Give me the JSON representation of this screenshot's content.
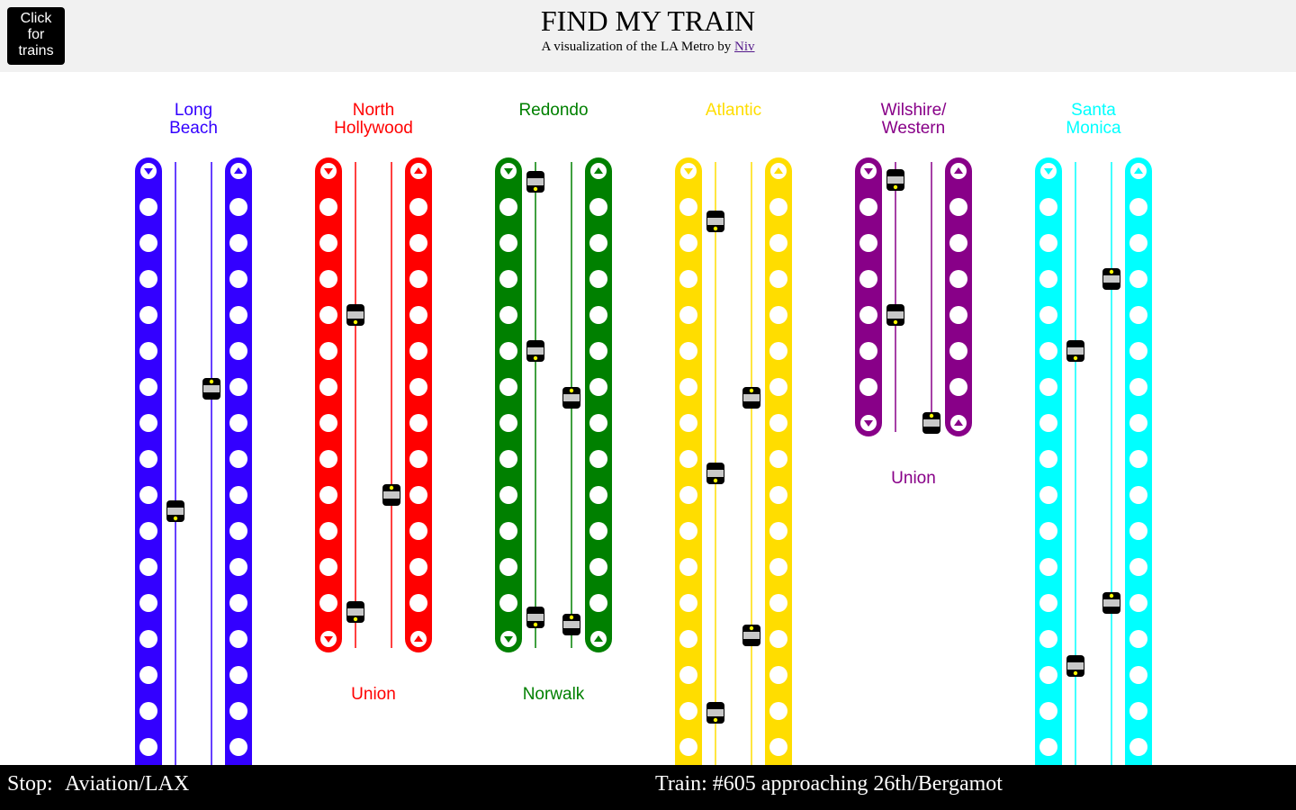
{
  "header": {
    "title": "FIND MY TRAIN",
    "subtitle_prefix": "A visualization of the LA Metro by ",
    "author_link": "Niv",
    "trains_button": [
      "Click",
      "for",
      "trains"
    ]
  },
  "lines": [
    {
      "id": "blue",
      "color": "#3300ff",
      "top_label": [
        "Long",
        "Beach"
      ],
      "bottom_label": "",
      "stops": 17,
      "continues": true,
      "trains": {
        "down": [
          9.45
        ],
        "up": [
          6.05
        ]
      }
    },
    {
      "id": "red",
      "color": "#ff0000",
      "top_label": [
        "North",
        "Hollywood"
      ],
      "bottom_label": "Union",
      "stops": 14,
      "continues": false,
      "trains": {
        "down": [
          4.0,
          12.25
        ],
        "up": [
          9.0
        ]
      }
    },
    {
      "id": "green",
      "color": "#008000",
      "top_label": [
        "Redondo"
      ],
      "bottom_label": "Norwalk",
      "stops": 14,
      "continues": false,
      "trains": {
        "down": [
          0.3,
          5.0,
          12.4
        ],
        "up": [
          6.3,
          12.6
        ]
      }
    },
    {
      "id": "gold",
      "color": "#ffdd00",
      "top_label": [
        "Atlantic"
      ],
      "bottom_label": "",
      "stops": 17,
      "continues": true,
      "trains": {
        "down": [
          1.4,
          8.4,
          15.05
        ],
        "up": [
          6.3,
          12.9
        ]
      }
    },
    {
      "id": "purple",
      "color": "#880088",
      "top_label": [
        "Wilshire/",
        "Western"
      ],
      "bottom_label": "Union",
      "stops": 8,
      "continues": false,
      "trains": {
        "down": [
          0.25,
          4.0
        ],
        "up": [
          7.0
        ]
      }
    },
    {
      "id": "expo",
      "color": "#00ffff",
      "top_label": [
        "Santa",
        "Monica"
      ],
      "bottom_label": "",
      "stops": 17,
      "continues": true,
      "trains": {
        "down": [
          5.0,
          13.75
        ],
        "up": [
          3.0,
          12.0
        ]
      }
    }
  ],
  "status_bar": {
    "stop_label": "Stop:",
    "stop_value": "Aviation/LAX",
    "train_status": "Train: #605 approaching 26th/Bergamot"
  }
}
